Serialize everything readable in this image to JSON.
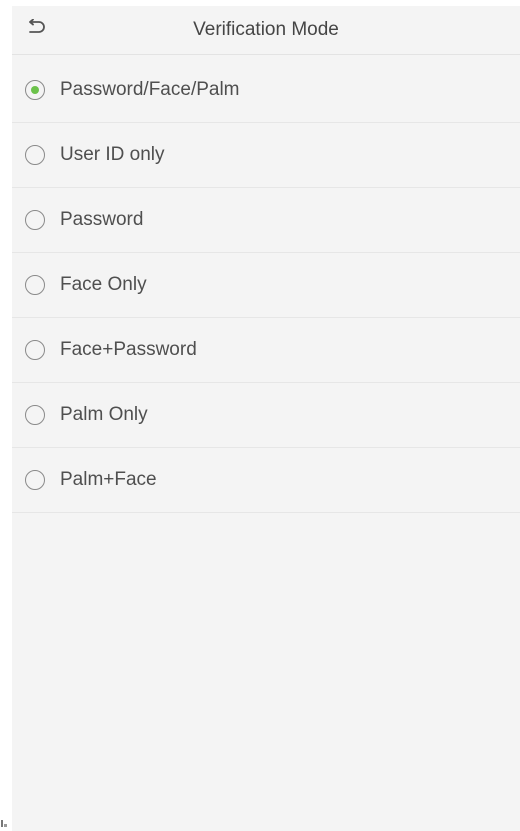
{
  "header": {
    "title": "Verification Mode",
    "back_icon": "back-arrow-icon"
  },
  "options": [
    {
      "label": "Password/Face/Palm",
      "selected": true
    },
    {
      "label": "User ID only",
      "selected": false
    },
    {
      "label": "Password",
      "selected": false
    },
    {
      "label": "Face Only",
      "selected": false
    },
    {
      "label": "Face+Password",
      "selected": false
    },
    {
      "label": "Palm Only",
      "selected": false
    },
    {
      "label": "Palm+Face",
      "selected": false
    }
  ],
  "colors": {
    "background": "#f4f4f4",
    "selected_dot": "#6cc24a",
    "text": "#4f4f4f",
    "divider": "#e6e6e6"
  }
}
